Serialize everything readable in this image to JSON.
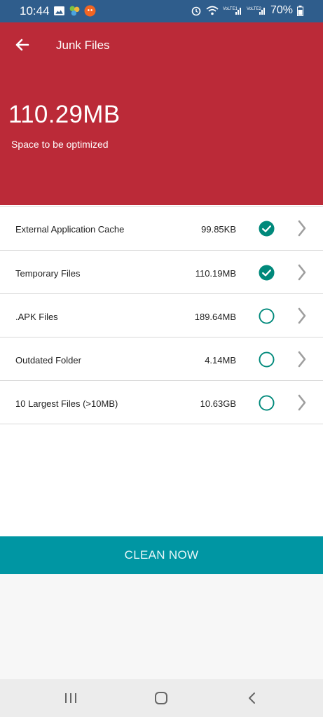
{
  "status_bar": {
    "time": "10:44",
    "battery": "70%",
    "bg_color": "#2f5d8c"
  },
  "header": {
    "title": "Junk Files",
    "space_value": "110.29MB",
    "space_label": "Space to be optimized",
    "bg_color": "#bb2a38"
  },
  "items": [
    {
      "name": "External Application Cache",
      "size": "99.85KB",
      "checked": true
    },
    {
      "name": "Temporary Files",
      "size": "110.19MB",
      "checked": true
    },
    {
      "name": ".APK Files",
      "size": "189.64MB",
      "checked": false
    },
    {
      "name": "Outdated Folder",
      "size": "4.14MB",
      "checked": false
    },
    {
      "name": "10 Largest Files (>10MB)",
      "size": "10.63GB",
      "checked": false
    }
  ],
  "clean_button": {
    "label": "CLEAN NOW",
    "bg_color": "#0096a3"
  },
  "accent_color": "#00897b",
  "icons": {
    "back": "arrow-left-icon",
    "chevron": "chevron-right-icon",
    "nav": [
      "recent-apps-icon",
      "home-icon",
      "back-icon"
    ]
  }
}
